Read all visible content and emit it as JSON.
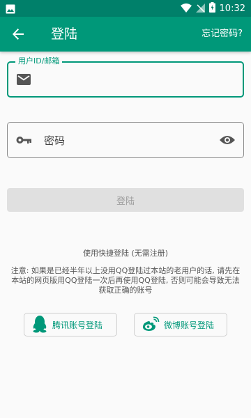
{
  "status_bar": {
    "time": "10:32"
  },
  "app_bar": {
    "title": "登陆",
    "forgot_link": "忘记密码?"
  },
  "form": {
    "user_label": "用户ID/邮箱",
    "user_value": "",
    "password_placeholder": "密码"
  },
  "login_button": "登陆",
  "quick_login": {
    "title": "使用快捷登陆 (无需注册)",
    "notice": "注意: 如果是已经半年以上没用QQ登陆过本站的老用户的话, 请先在本站的网页版用QQ登陆一次后再使用QQ登陆, 否则可能会导致无法获取正确的账号",
    "qq_button": "腾讯账号登陆",
    "weibo_button": "微博账号登陆"
  },
  "colors": {
    "primary": "#009879",
    "status_bar": "#00806a"
  },
  "icons": [
    "gallery-icon",
    "wifi-icon",
    "no-sim-icon",
    "battery-icon",
    "back-arrow-icon",
    "email-icon",
    "key-icon",
    "eye-icon",
    "qq-icon",
    "weibo-icon"
  ]
}
